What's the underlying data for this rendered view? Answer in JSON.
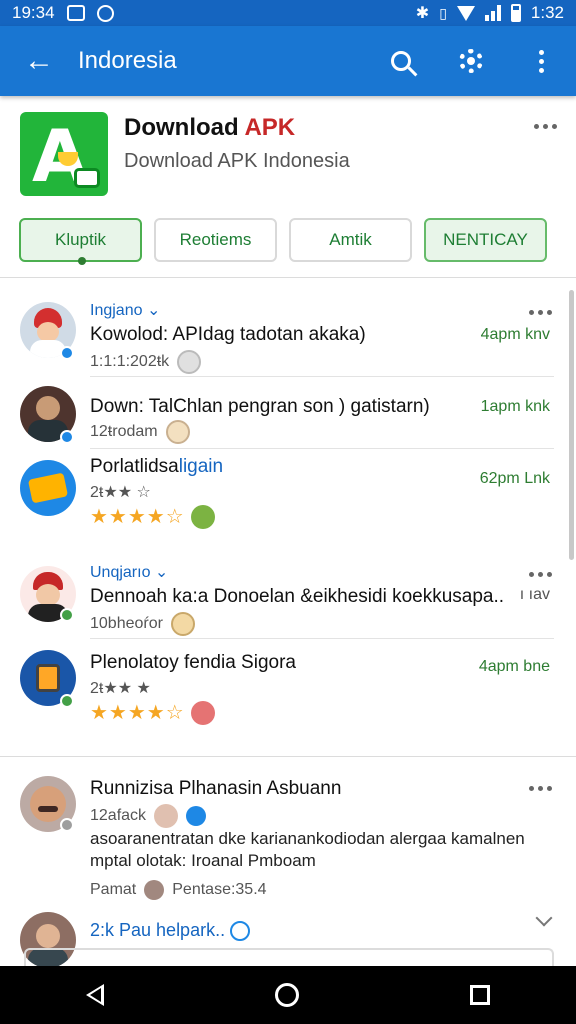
{
  "status_bar": {
    "time_left": "19:34",
    "time_right": "1:32"
  },
  "app_bar": {
    "title": "Indoresia"
  },
  "app_header": {
    "name_part1": "Download ",
    "name_part2": "APK",
    "subtitle": "Download APK Indonesia"
  },
  "tabs": [
    {
      "label": "Kluptik"
    },
    {
      "label": "Reotiems"
    },
    {
      "label": "Amtik"
    },
    {
      "label": "NENTICAY"
    }
  ],
  "posts": [
    {
      "user": "Ingjano ⌄",
      "title": "Kowolod: APIdag tadotan akaka)",
      "meta": "1:1:1:202ŧk",
      "time": "4apm knv"
    },
    {
      "title": "Down: TalChlan pengran son ) gatistarn)",
      "meta": "12ŧrodam",
      "time": "1apm knk"
    },
    {
      "title": "Porlatlidsa",
      "title_link": "ligain",
      "meta": "2ŧ★★ ☆",
      "time": "62pm Lnk",
      "stars": "★★★★☆"
    },
    {
      "user": "Unqjarıo ⌄",
      "title": "Dennoah ka:a Donoelan &eikhesidi koekkusapa..",
      "meta": "10bheoŕor",
      "time": "ı ıav"
    },
    {
      "title": "Plenolatoy fendia Sigora",
      "meta": "2ŧ★★ ★",
      "time": "4apm bne",
      "stars": "★★★★☆"
    }
  ],
  "comment": {
    "name": "Runnizisa Plhanasin Asbuann",
    "meta": "12afack",
    "text": "asoaranentratan dke karianankodiodan alergaa kamalnen mptal olotak: Iroanal Pmboam",
    "footer_left": "Pamat",
    "footer_right": "Pentase:35.4"
  },
  "reply": {
    "text": "2:k Pau helpark.."
  },
  "colors": {
    "primary": "#1976d2",
    "status": "#1565c0",
    "accent_green": "#2e7d32",
    "star": "#f5a623"
  }
}
